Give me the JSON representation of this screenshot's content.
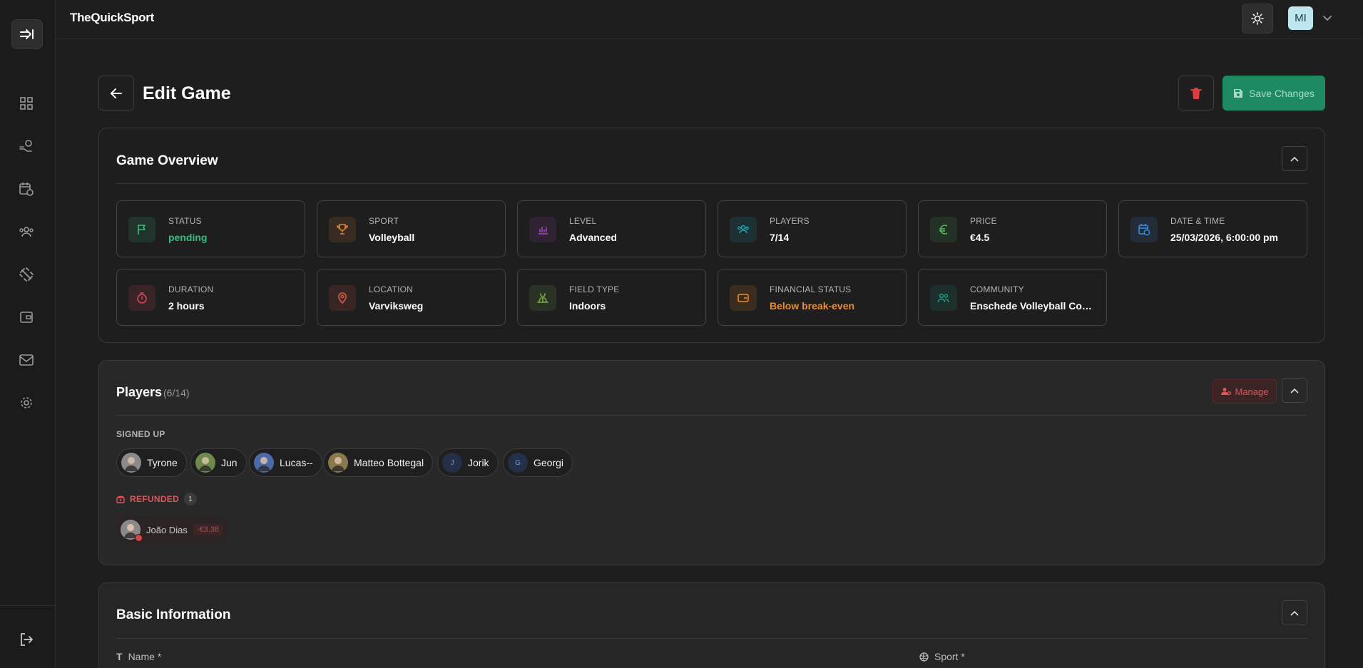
{
  "app": {
    "logo_text": "TheQuickSport"
  },
  "topbar": {
    "user_initials": "MI"
  },
  "header": {
    "title": "Edit Game",
    "save_label": "Save Changes"
  },
  "overview": {
    "title": "Game Overview",
    "tiles": [
      {
        "label": "STATUS",
        "value": "pending",
        "icon": "flag-icon",
        "color": "#2ec27e"
      },
      {
        "label": "SPORT",
        "value": "Volleyball",
        "icon": "trophy-icon",
        "color": "#e38a2a"
      },
      {
        "label": "LEVEL",
        "value": "Advanced",
        "icon": "bar-chart-icon",
        "color": "#9b3fb5"
      },
      {
        "label": "PLAYERS",
        "value": "7/14",
        "icon": "users-icon",
        "color": "#19a7b8"
      },
      {
        "label": "PRICE",
        "value": "€4.5",
        "icon": "euro-icon",
        "color": "#4caf50"
      },
      {
        "label": "DATE & TIME",
        "value": "25/03/2026, 6:00:00 pm",
        "icon": "calendar-clock-icon",
        "color": "#3a8ee6"
      },
      {
        "label": "DURATION",
        "value": "2 hours",
        "icon": "timer-icon",
        "color": "#e0435a"
      },
      {
        "label": "LOCATION",
        "value": "Varviksweg",
        "icon": "map-pin-icon",
        "color": "#e05a3a"
      },
      {
        "label": "FIELD TYPE",
        "value": "Indoors",
        "icon": "grass-icon",
        "color": "#7ab648"
      },
      {
        "label": "FINANCIAL STATUS",
        "value": "Below break-even",
        "icon": "wallet-icon",
        "color": "#f28c1e"
      },
      {
        "label": "COMMUNITY",
        "value": "Enschede Volleyball Com...",
        "icon": "community-icon",
        "color": "#16a085"
      }
    ]
  },
  "players": {
    "title": "Players",
    "count": "(6/14)",
    "manage_label": "Manage",
    "signed_up_label": "SIGNED UP",
    "signed_up": [
      {
        "name": "Tyrone",
        "initial": ""
      },
      {
        "name": "Jun",
        "initial": ""
      },
      {
        "name": "Lucas--",
        "initial": ""
      },
      {
        "name": "Matteo Bottegal",
        "initial": ""
      },
      {
        "name": "Jorik",
        "initial": "J"
      },
      {
        "name": "Georgi",
        "initial": "G"
      }
    ],
    "refunded_label": "REFUNDED",
    "refunded_count": "1",
    "refunded": [
      {
        "name": "João Dias",
        "amount": "-€3.38"
      }
    ]
  },
  "basic": {
    "title": "Basic Information",
    "name_label": "Name *",
    "sport_label": "Sport *"
  },
  "colors": {
    "accent_green": "#1e8a62",
    "danger": "#e05656"
  }
}
